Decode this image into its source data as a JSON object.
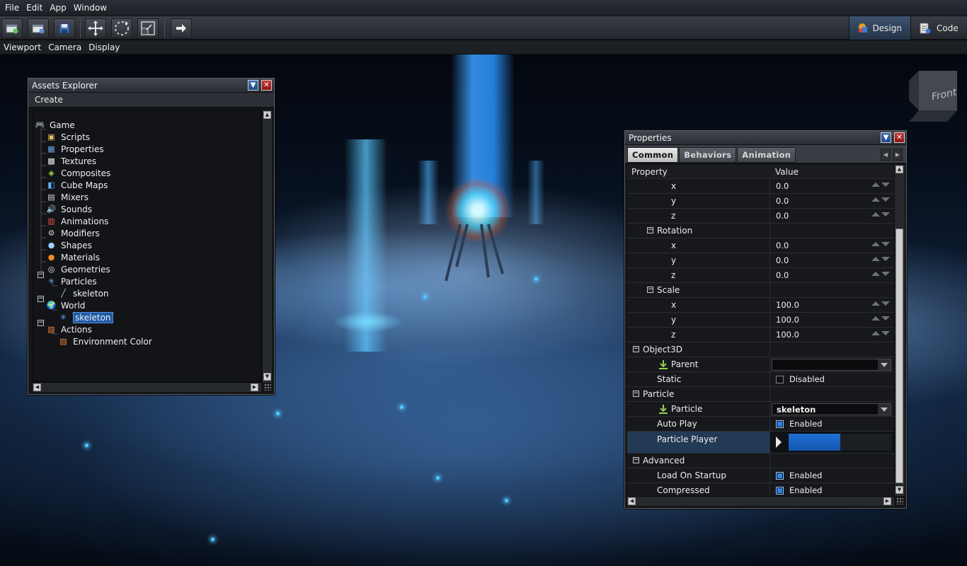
{
  "menubar": {
    "items": [
      "File",
      "Edit",
      "App",
      "Window"
    ]
  },
  "toolbar": {
    "buttons": [
      "new-scene-icon",
      "open-icon",
      "save-icon",
      "move-icon",
      "rotate-icon",
      "scale-icon",
      "play-icon"
    ],
    "modes": [
      {
        "label": "Design",
        "icon": "design-icon",
        "active": true
      },
      {
        "label": "Code",
        "icon": "code-icon",
        "active": false
      }
    ]
  },
  "viewbar": {
    "items": [
      "Viewport",
      "Camera",
      "Display"
    ]
  },
  "viewport": {
    "nav_cube_label": "Front"
  },
  "assets_explorer": {
    "title": "Assets Explorer",
    "create_label": "Create",
    "tree": [
      {
        "label": "Game",
        "icon": "gamepad-icon",
        "depth": 0
      },
      {
        "label": "Scripts",
        "icon": "script-icon",
        "depth": 1
      },
      {
        "label": "Properties",
        "icon": "properties-icon",
        "depth": 1
      },
      {
        "label": "Textures",
        "icon": "texture-icon",
        "depth": 1
      },
      {
        "label": "Composites",
        "icon": "composite-icon",
        "depth": 1
      },
      {
        "label": "Cube Maps",
        "icon": "cubemap-icon",
        "depth": 1
      },
      {
        "label": "Mixers",
        "icon": "mixer-icon",
        "depth": 1
      },
      {
        "label": "Sounds",
        "icon": "sound-icon",
        "depth": 1
      },
      {
        "label": "Animations",
        "icon": "animation-icon",
        "depth": 1
      },
      {
        "label": "Modifiers",
        "icon": "modifier-icon",
        "depth": 1
      },
      {
        "label": "Shapes",
        "icon": "shape-icon",
        "depth": 1
      },
      {
        "label": "Materials",
        "icon": "material-icon",
        "depth": 1
      },
      {
        "label": "Geometries",
        "icon": "geometry-icon",
        "depth": 1
      },
      {
        "label": "Particles",
        "icon": "particles-icon",
        "depth": 1
      },
      {
        "label": "skeleton",
        "icon": "particle-asset-icon",
        "depth": 2
      },
      {
        "label": "World",
        "icon": "world-icon",
        "depth": 1
      },
      {
        "label": "skeleton",
        "icon": "particle-node-icon",
        "depth": 2,
        "selected": true
      },
      {
        "label": "Actions",
        "icon": "actions-icon",
        "depth": 1
      },
      {
        "label": "Environment Color",
        "icon": "action-icon",
        "depth": 2
      }
    ]
  },
  "properties": {
    "title": "Properties",
    "tabs": [
      {
        "label": "Common",
        "active": true
      },
      {
        "label": "Behaviors",
        "active": false
      },
      {
        "label": "Animation",
        "active": false
      }
    ],
    "header": {
      "property": "Property",
      "value": "Value"
    },
    "rows": [
      {
        "kind": "num",
        "name": "x",
        "value": "0.0"
      },
      {
        "kind": "num",
        "name": "y",
        "value": "0.0"
      },
      {
        "kind": "num",
        "name": "z",
        "value": "0.0"
      },
      {
        "kind": "subgroup",
        "name": "Rotation"
      },
      {
        "kind": "num",
        "name": "x",
        "value": "0.0"
      },
      {
        "kind": "num",
        "name": "y",
        "value": "0.0"
      },
      {
        "kind": "num",
        "name": "z",
        "value": "0.0"
      },
      {
        "kind": "subgroup",
        "name": "Scale"
      },
      {
        "kind": "num",
        "name": "x",
        "value": "100.0"
      },
      {
        "kind": "num",
        "name": "y",
        "value": "100.0"
      },
      {
        "kind": "num",
        "name": "z",
        "value": "100.0"
      },
      {
        "kind": "group",
        "name": "Object3D"
      },
      {
        "kind": "combo",
        "name": "Parent",
        "value": ""
      },
      {
        "kind": "check",
        "name": "Static",
        "value": "Disabled",
        "checked": false
      },
      {
        "kind": "group",
        "name": "Particle"
      },
      {
        "kind": "combo",
        "name": "Particle",
        "value": "skeleton"
      },
      {
        "kind": "check",
        "name": "Auto Play",
        "value": "Enabled",
        "checked": true
      },
      {
        "kind": "player",
        "name": "Particle Player",
        "progress": 0.5
      },
      {
        "kind": "group",
        "name": "Advanced"
      },
      {
        "kind": "check",
        "name": "Load On Startup",
        "value": "Enabled",
        "checked": true
      },
      {
        "kind": "check",
        "name": "Compressed",
        "value": "Enabled",
        "checked": true
      }
    ]
  },
  "colors": {
    "accent": "#1e5aa6",
    "checkbox_on": "#2a84ea",
    "beam": "#2f9bff"
  }
}
